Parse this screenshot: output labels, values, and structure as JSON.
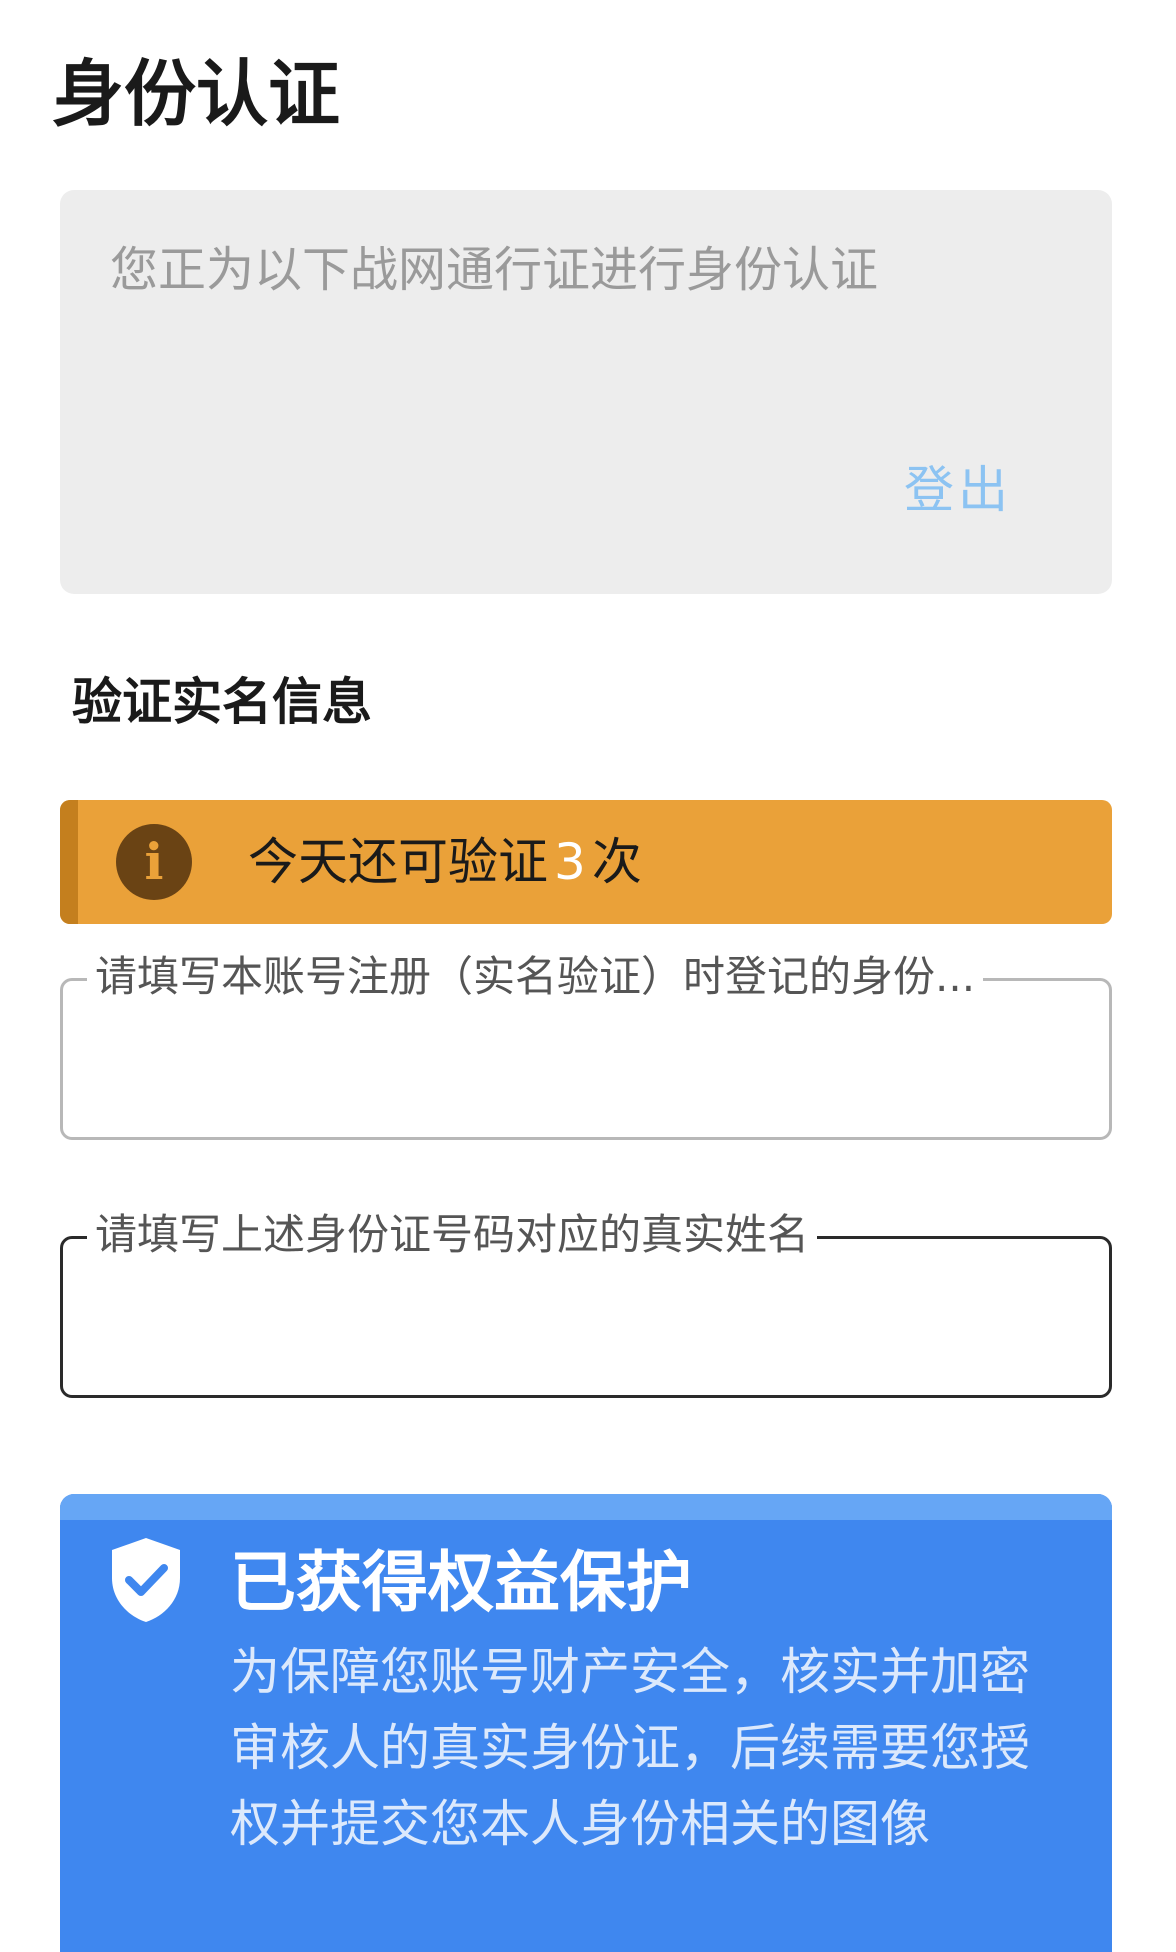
{
  "page": {
    "title": "身份认证"
  },
  "account_card": {
    "note": "您正为以下战网通行证进行身份认证",
    "logout_label": "登出",
    "logout_color": "#8cc3f2"
  },
  "section": {
    "title": "验证实名信息"
  },
  "notice": {
    "prefix": "今天还可验证",
    "count": "3",
    "suffix": "次",
    "icon": "info-icon",
    "bar_color": "#eaa139"
  },
  "form": {
    "id_field": {
      "label": "请填写本账号注册（实名验证）时登记的身份...",
      "value": ""
    },
    "name_field": {
      "label": "请填写上述身份证号码对应的真实姓名",
      "value": ""
    }
  },
  "protection": {
    "icon": "shield-check-icon",
    "title": "已获得权益保护",
    "description": "为保障您账号财产安全，核实并加密审核人的真实身份证，后续需要您授权并提交您本人身份相关的图像",
    "card_color": "#3f87ef"
  }
}
